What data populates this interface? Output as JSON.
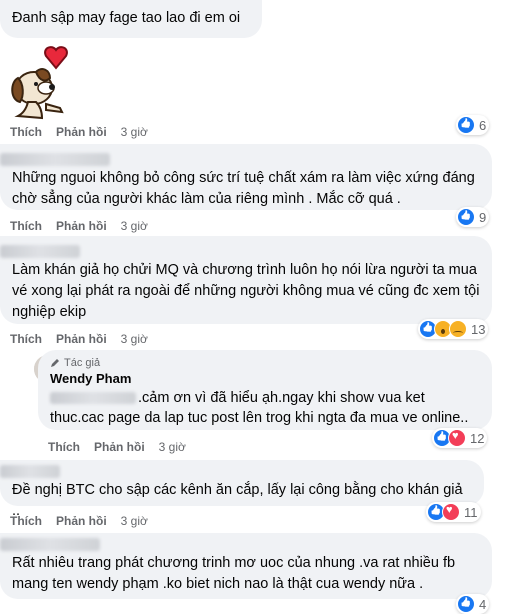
{
  "actions": {
    "like_label": "Thích",
    "reply_label": "Phản hồi"
  },
  "comments": [
    {
      "text": "Đanh sập may fage tao lao đi em oi",
      "time": "3 giờ",
      "reactions": "6"
    },
    {
      "text": "Những nguoi không bỏ công sức trí tuệ chất xám ra làm việc xứng đáng chờ sẳng của người khác làm của riêng mình . Mắc cỡ quá .",
      "time": "3 giờ",
      "reactions": "9"
    },
    {
      "text": "Làm khán giả họ chửi MQ và chương trình luôn họ nói lừa người ta mua vé xong lại phát ra ngoài để những người không mua vé cũng đc xem tội nghiệp ekip",
      "time": "3 giờ",
      "reactions": "13"
    },
    {
      "author_badge": "Tác giả",
      "author_name": "Wendy Pham",
      "text_line1": ".cảm ơn vì đã hiểu ạh.ngay khi show vua ket",
      "text_line2": "thuc.cac page da lap tuc post lên trog khi ngta đa mua ve online..",
      "time": "3 giờ",
      "reactions": "12"
    },
    {
      "text": "Đề nghị BTC cho sập các kênh ăn cắp, lấy lại công bằng cho khán giả ..",
      "time": "3 giờ",
      "reactions": "11"
    },
    {
      "text": "Rất nhiêu trang phát chương trinh mơ uoc của nhung .va rat nhiều fb mang ten wendy phạm .ko biet nich nao là thật cua wendy nữa .",
      "reactions": "4"
    }
  ]
}
